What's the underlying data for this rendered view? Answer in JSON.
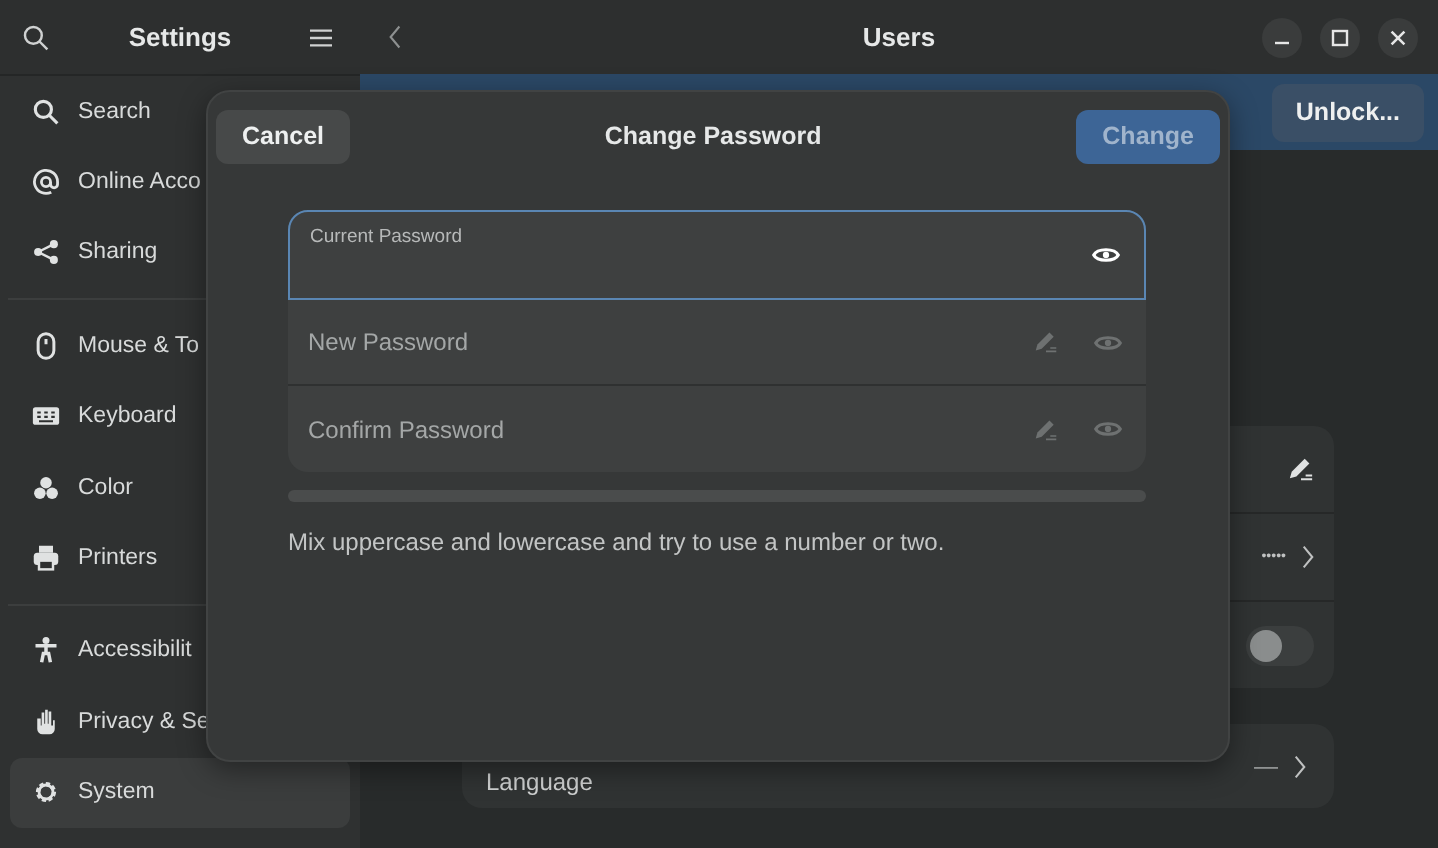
{
  "sidebar": {
    "title": "Settings",
    "groups": [
      [
        {
          "label": "Search",
          "selected": false
        },
        {
          "label": "Online Acco",
          "selected": false
        },
        {
          "label": "Sharing",
          "selected": false
        }
      ],
      [
        {
          "label": "Mouse & To",
          "selected": false
        },
        {
          "label": "Keyboard",
          "selected": false
        },
        {
          "label": "Color",
          "selected": false
        },
        {
          "label": "Printers",
          "selected": false
        }
      ],
      [
        {
          "label": "Accessibilit",
          "selected": false
        },
        {
          "label": "Privacy & Se",
          "selected": false
        },
        {
          "label": "System",
          "selected": true
        }
      ]
    ]
  },
  "header": {
    "title": "Users"
  },
  "banner": {
    "button": "Unlock..."
  },
  "account_card": {
    "rows": [
      {
        "kind": "edit"
      },
      {
        "kind": "value",
        "value": "•••••"
      },
      {
        "kind": "toggle",
        "on": false
      }
    ]
  },
  "language_row": {
    "label": "Language",
    "value": "—"
  },
  "dialog": {
    "title": "Change Password",
    "cancel": "Cancel",
    "confirm": {
      "label": "Change",
      "disabled": true
    },
    "fields": [
      {
        "kind": "current",
        "label": "Current Password",
        "focused": true
      },
      {
        "kind": "new",
        "label": "New Password",
        "focused": false
      },
      {
        "kind": "confirm",
        "label": "Confirm Password",
        "focused": false
      }
    ],
    "strength": {
      "level": 0
    },
    "hint": "Mix uppercase and lowercase and try to use a number or two."
  }
}
